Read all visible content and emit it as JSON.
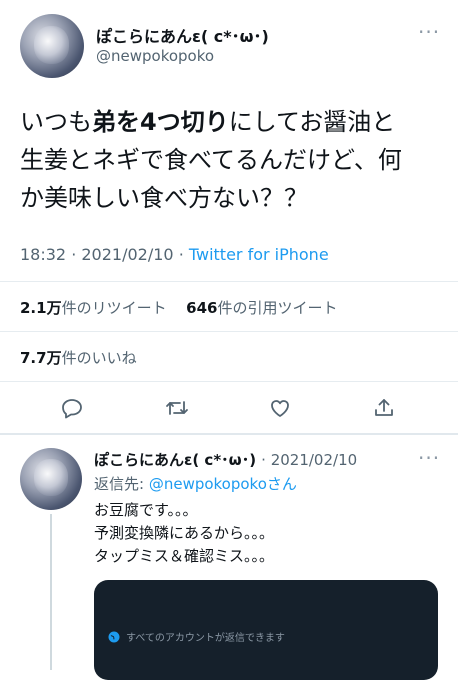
{
  "tweet": {
    "author_name": "ぽこらにあんε( c*･ω･)",
    "author_handle": "@newpokopoko",
    "more_icon": "more-dots-icon",
    "lines": [
      [
        "いつも",
        "弟を4つ切り",
        "にしてお醤油と"
      ],
      "生姜とネギで食べてるんだけど、何",
      "か美味しい食べ方ない？？"
    ],
    "time": "18:32",
    "date": "2021/02/10",
    "source": "Twitter for iPhone"
  },
  "stats": {
    "retweets_count": "2.1万",
    "retweets_label": "件のリツイート",
    "quotes_count": "646",
    "quotes_label": "件の引用ツイート",
    "likes_count": "7.7万",
    "likes_label": "件のいいね"
  },
  "actions": [
    "reply-icon",
    "retweet-icon",
    "like-icon",
    "share-icon"
  ],
  "reply": {
    "author_name": "ぽこらにあんε( c*･ω･)",
    "date": "2021/02/10",
    "replying_prefix": "返信先: ",
    "replying_handle": "@newpokopoko",
    "replying_suffix": "さん",
    "lines": [
      "お豆腐です。。。",
      "予測変換隣にあるから。。。",
      "タップミス＆確認ミス。。。"
    ],
    "embed_notice": "すべてのアカウントが返信できます"
  },
  "colors": {
    "accent": "#1d9bf0",
    "text": "#0f1419",
    "muted": "#536471",
    "embed_bg": "#15202b"
  }
}
